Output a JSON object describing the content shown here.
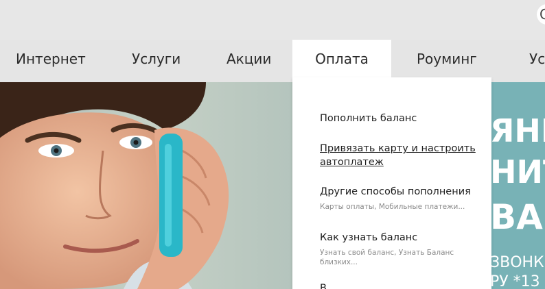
{
  "corner_button": {
    "label": "С"
  },
  "nav": {
    "items": [
      {
        "label": "Интернет"
      },
      {
        "label": "Услуги"
      },
      {
        "label": "Акции"
      },
      {
        "label": "Оплата"
      },
      {
        "label": "Роуминг"
      },
      {
        "label": "Ус"
      }
    ],
    "active_index": 3
  },
  "dropdown": {
    "items": [
      {
        "label": "Пополнить баланс",
        "sub": ""
      },
      {
        "label": "Привязать карту и настроить автоплатеж",
        "sub": ""
      },
      {
        "label": "Другие способы пополнения",
        "sub": "Карты оплаты, Мобильные платежи..."
      },
      {
        "label": "Как узнать баланс",
        "sub": "Узнать свой баланс, Узнать Баланс близких..."
      },
      {
        "label": "В",
        "sub": ""
      }
    ]
  },
  "banner": {
    "lines": [
      "ЯНЕ",
      "НИТ",
      "ВАЕ",
      "ЗВОНК",
      "РУ *13"
    ]
  },
  "colors": {
    "accent": "#78b2b6",
    "nav_bg": "#e5e5e5",
    "dropdown_bg": "#ffffff",
    "handset": "#2ab7c8"
  }
}
